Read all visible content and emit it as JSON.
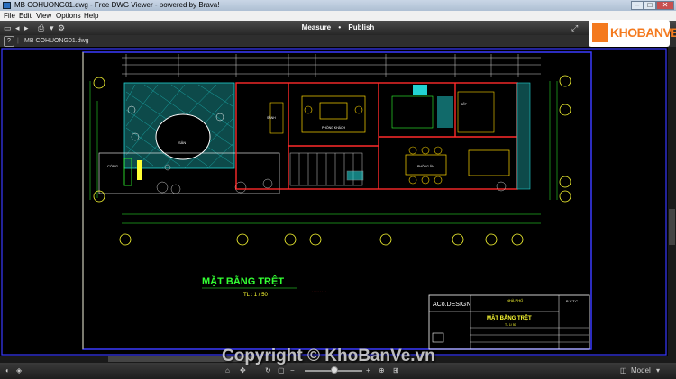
{
  "window": {
    "title": "MB COHUONG01.dwg - Free DWG Viewer - powered by Brava!"
  },
  "menu": [
    "File",
    "Edit",
    "View",
    "Options",
    "Help"
  ],
  "toolbar": {
    "measure_label": "Measure",
    "publish_label": "Publish",
    "separator": "•"
  },
  "tab": {
    "filename": "MB COHUONG01.dwg",
    "help": "?"
  },
  "drawing": {
    "plan_title": "MẶT BẰNG TRỆT",
    "scale": "TL : 1 / 50",
    "room_labels": [
      "CỔNG",
      "PHÒNG KHÁCH",
      "PHÒNG ĂN",
      "BẾP",
      "SÂN",
      "SẢNH"
    ],
    "titleblock": {
      "company": "ACo.DESIGN",
      "project": "NHÀ PHỐ",
      "sheet_title": "MẶT BẰNG TRỆT",
      "sheet_scale": "TL 1/ 50",
      "sheet_id": "B.V.T.C"
    }
  },
  "statusbar": {
    "model_label": "Model"
  },
  "logo": {
    "text": "KHOBANVE"
  },
  "watermark": {
    "text": "Copyright © KhoBanVe.vn"
  },
  "colors": {
    "background": "#000000",
    "viewport_border": "#3a3aff",
    "wall": "#ff2a2a",
    "hatch": "#22d3d3",
    "dimension": "#33ff33",
    "logo": "#f47a1f"
  }
}
